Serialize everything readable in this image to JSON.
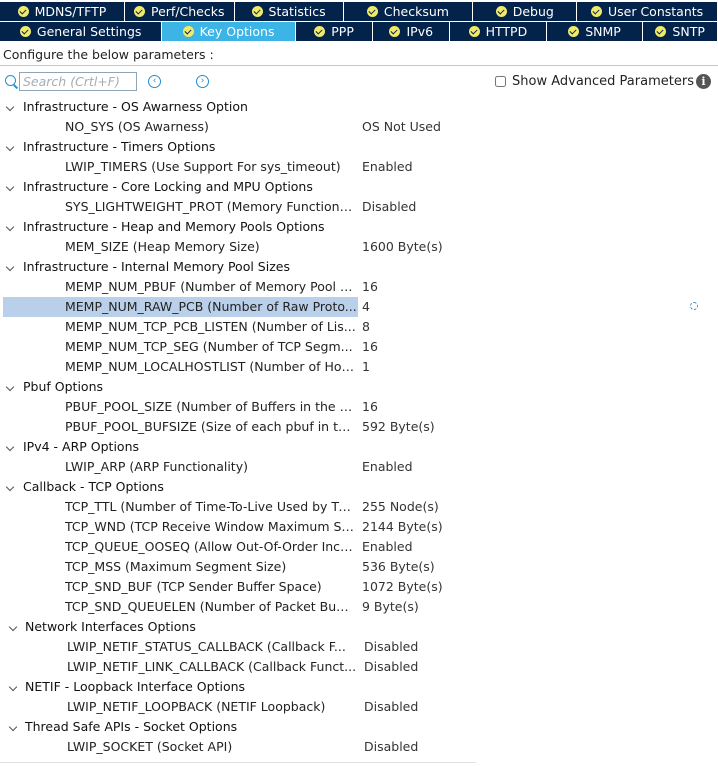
{
  "tabs_row1": [
    {
      "label": "MDNS/TFTP",
      "width": 124,
      "active": false
    },
    {
      "label": "Perf/Checks",
      "width": 109,
      "active": false
    },
    {
      "label": "Statistics",
      "width": 108,
      "active": false
    },
    {
      "label": "Checksum",
      "width": 129,
      "active": false
    },
    {
      "label": "Debug",
      "width": 103,
      "active": false
    },
    {
      "label": "User Constants",
      "width": 140,
      "active": false
    }
  ],
  "tabs_row2": [
    {
      "label": "General Settings",
      "width": 162,
      "active": false
    },
    {
      "label": "Key Options",
      "width": 133,
      "active": true
    },
    {
      "label": "PPP",
      "width": 77,
      "active": false
    },
    {
      "label": "IPv6",
      "width": 76,
      "active": false
    },
    {
      "label": "HTTPD",
      "width": 96,
      "active": false
    },
    {
      "label": "SNMP",
      "width": 96,
      "active": false
    },
    {
      "label": "SNTP",
      "width": 74,
      "active": false
    }
  ],
  "configure_label": "Configure the below parameters :",
  "search": {
    "placeholder": "Search (Crtl+F)",
    "value": ""
  },
  "nav": {
    "prev": "‹",
    "next": "›"
  },
  "advanced_label": "Show Advanced Parameters",
  "info_glyph": "i",
  "groups": [
    {
      "name": "Infrastructure - OS Awarness Option",
      "style": 1,
      "params": [
        {
          "name": "NO_SYS (OS Awarness)",
          "value": "OS Not Used"
        }
      ]
    },
    {
      "name": "Infrastructure - Timers Options",
      "style": 1,
      "params": [
        {
          "name": "LWIP_TIMERS (Use Support For sys_timeout)",
          "value": "Enabled"
        }
      ]
    },
    {
      "name": "Infrastructure - Core Locking and MPU Options",
      "style": 1,
      "params": [
        {
          "name": "SYS_LIGHTWEIGHT_PROT (Memory Functions...",
          "value": "Disabled"
        }
      ]
    },
    {
      "name": "Infrastructure - Heap and Memory Pools Options",
      "style": 1,
      "params": [
        {
          "name": "MEM_SIZE (Heap Memory Size)",
          "value": "1600 Byte(s)"
        }
      ]
    },
    {
      "name": "Infrastructure - Internal Memory Pool Sizes",
      "style": 1,
      "params": [
        {
          "name": "MEMP_NUM_PBUF (Number of Memory Pool st...",
          "value": "16"
        },
        {
          "name": "MEMP_NUM_RAW_PCB (Number of Raw Proto...",
          "value": "4",
          "selected": true
        },
        {
          "name": "MEMP_NUM_TCP_PCB_LISTEN (Number of Lis...",
          "value": "8"
        },
        {
          "name": "MEMP_NUM_TCP_SEG (Number of TCP Segm...",
          "value": "16"
        },
        {
          "name": "MEMP_NUM_LOCALHOSTLIST (Number of Hos...",
          "value": "1"
        }
      ]
    },
    {
      "name": "Pbuf Options",
      "style": 1,
      "params": [
        {
          "name": "PBUF_POOL_SIZE (Number of Buffers in the Pb...",
          "value": "16"
        },
        {
          "name": "PBUF_POOL_BUFSIZE (Size of each pbuf in th...",
          "value": "592 Byte(s)"
        }
      ]
    },
    {
      "name": "IPv4 - ARP Options",
      "style": 1,
      "params": [
        {
          "name": "LWIP_ARP (ARP Functionality)",
          "value": "Enabled"
        }
      ]
    },
    {
      "name": "Callback - TCP Options",
      "style": 1,
      "params": [
        {
          "name": "TCP_TTL (Number of Time-To-Live Used by TCP ...",
          "value": "255 Node(s)"
        },
        {
          "name": "TCP_WND (TCP Receive Window Maximum Size)",
          "value": "2144 Byte(s)"
        },
        {
          "name": "TCP_QUEUE_OOSEQ (Allow Out-Of-Order Inco...",
          "value": "Enabled"
        },
        {
          "name": "TCP_MSS (Maximum Segment Size)",
          "value": "536 Byte(s)"
        },
        {
          "name": "TCP_SND_BUF (TCP Sender Buffer Space)",
          "value": "1072 Byte(s)"
        },
        {
          "name": "TCP_SND_QUEUELEN (Number of Packet Buffe...",
          "value": "9 Byte(s)"
        }
      ]
    },
    {
      "name": "Network Interfaces Options",
      "style": 2,
      "params": [
        {
          "name": "LWIP_NETIF_STATUS_CALLBACK (Callback F...",
          "value": "Disabled"
        },
        {
          "name": "LWIP_NETIF_LINK_CALLBACK (Callback Funct...",
          "value": "Disabled"
        }
      ]
    },
    {
      "name": "NETIF - Loopback Interface Options",
      "style": 2,
      "params": [
        {
          "name": "LWIP_NETIF_LOOPBACK (NETIF Loopback)",
          "value": "Disabled"
        }
      ]
    },
    {
      "name": "Thread Safe APIs - Socket Options",
      "style": 2,
      "params": [
        {
          "name": "LWIP_SOCKET (Socket API)",
          "value": "Disabled"
        }
      ]
    }
  ]
}
